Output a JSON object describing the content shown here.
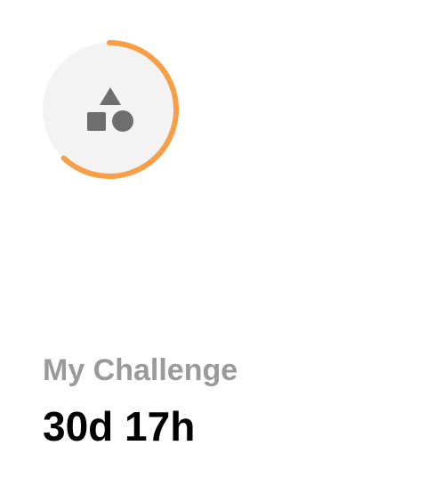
{
  "challenge": {
    "title": "My Challenge",
    "time_remaining": "30d 17h",
    "progress": 0.62,
    "icon": "shapes-icon",
    "colors": {
      "progress": "#FA9E45",
      "track": "#F3F3F3",
      "icon": "#6E6E6E",
      "title": "#9A9A9A",
      "value": "#000000"
    }
  }
}
